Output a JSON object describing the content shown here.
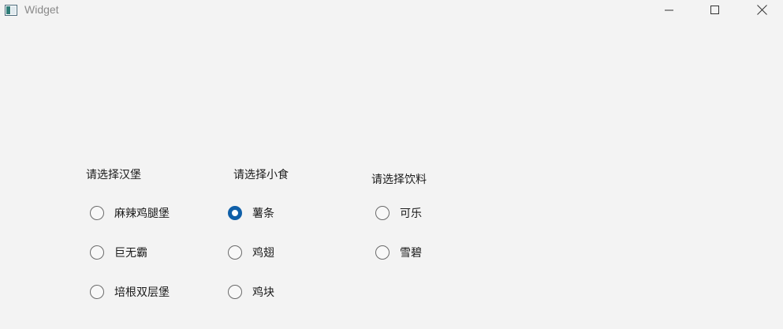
{
  "window": {
    "title": "Widget",
    "icons": {
      "app": "app-window-icon",
      "minimize": "minimize-icon",
      "maximize": "maximize-icon",
      "close": "close-icon"
    }
  },
  "groups": [
    {
      "title": "请选择汉堡",
      "options": [
        {
          "label": "麻辣鸡腿堡",
          "checked": false
        },
        {
          "label": "巨无霸",
          "checked": false
        },
        {
          "label": "培根双层堡",
          "checked": false
        }
      ]
    },
    {
      "title": "请选择小食",
      "options": [
        {
          "label": "薯条",
          "checked": true
        },
        {
          "label": "鸡翅",
          "checked": false
        },
        {
          "label": "鸡块",
          "checked": false
        }
      ]
    },
    {
      "title": "请选择饮料",
      "options": [
        {
          "label": "可乐",
          "checked": false
        },
        {
          "label": "雪碧",
          "checked": false
        }
      ]
    }
  ],
  "colors": {
    "accent": "#0f5fa8",
    "background": "#f3f3f3"
  }
}
